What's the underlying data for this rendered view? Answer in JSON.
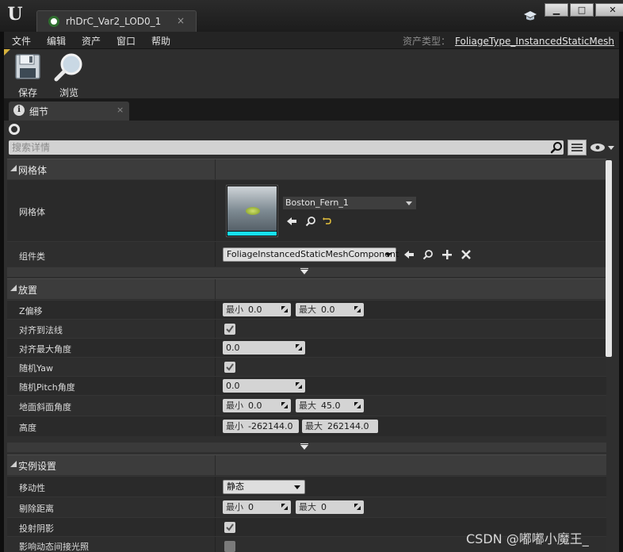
{
  "window": {
    "tab_title": "rhDrC_Var2_LOD0_1",
    "tab_close": "×",
    "min_glyph": "▁",
    "max_glyph": "□",
    "close_glyph": "✕"
  },
  "menu": {
    "items": [
      "文件",
      "编辑",
      "资产",
      "窗口",
      "帮助"
    ],
    "asset_type_label": "资产类型：",
    "asset_type_value": "FoliageType_InstancedStaticMesh"
  },
  "toolbar": {
    "save_label": "保存",
    "browse_label": "浏览"
  },
  "panel": {
    "tab_label": "细节",
    "tab_close": "×",
    "search_placeholder": "搜索详情"
  },
  "sections": {
    "mesh": {
      "title": "网格体",
      "mesh_label": "网格体",
      "mesh_value": "Boston_Fern_1",
      "component_label": "组件类",
      "component_value": "FoliageInstancedStaticMeshComponent"
    },
    "placement": {
      "title": "放置",
      "rows": [
        {
          "label": "Z偏移",
          "kind": "minmax",
          "min_prefix": "最小",
          "min": "0.0",
          "max_prefix": "最大",
          "max": "0.0"
        },
        {
          "label": "对齐到法线",
          "kind": "check",
          "checked": true
        },
        {
          "label": "对齐最大角度",
          "kind": "single",
          "value": "0.0"
        },
        {
          "label": "随机Yaw",
          "kind": "check",
          "checked": true
        },
        {
          "label": "随机Pitch角度",
          "kind": "single",
          "value": "0.0"
        },
        {
          "label": "地面斜面角度",
          "kind": "minmax",
          "min_prefix": "最小",
          "min": "0.0",
          "max_prefix": "最大",
          "max": "45.0"
        },
        {
          "label": "高度",
          "kind": "minmax",
          "min_prefix": "最小",
          "min": "-262144.0",
          "max_prefix": "最大",
          "max": "262144.0"
        }
      ]
    },
    "instance": {
      "title": "实例设置",
      "mobility_label": "移动性",
      "mobility_value": "静态",
      "cull_label": "剔除距离",
      "cull_min_prefix": "最小",
      "cull_min": "0",
      "cull_max_prefix": "最大",
      "cull_max": "0",
      "cast_shadow_label": "投射阴影",
      "cast_shadow_checked": true,
      "next_label": "影响动态间接光照"
    }
  },
  "watermark": "CSDN @嘟嘟小魔王_"
}
